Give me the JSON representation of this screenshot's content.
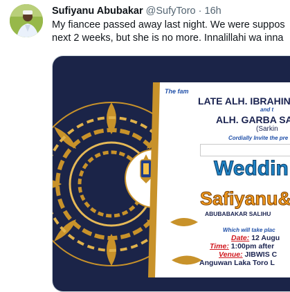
{
  "tweet": {
    "author_name": "Sufiyanu Abubakar",
    "handle": "@SufyToro",
    "separator": "·",
    "time": "16h",
    "text_line1": "My fiancee passed away last night. We were suppos",
    "text_line2": "next 2 weeks, but she is no more. Innalillahi wa inna"
  },
  "invitation": {
    "family_line": "The fam",
    "late_line": "LATE ALH. IBRAHIN",
    "and_the": "and t",
    "garba_line": "ALH. GARBA SA",
    "sarki_line": "(Sarkin",
    "cordially": "Cordially Invite the pre",
    "wedding": "Weddin",
    "groom": "Safiyanu",
    "amp": "&",
    "groom_full": "ABUBABAKAR SALIHU",
    "which_line": "Which will take plac",
    "date_label": "Date:",
    "date_value": "12 Augu",
    "time_label": "Time:",
    "time_value": "1:00pm after",
    "venue_label": "Venue:",
    "venue_value": "JIBWIS C",
    "location": "Anguwan Laka Toro L"
  },
  "colors": {
    "navy": "#1b2448",
    "gold": "#c8922a",
    "wedding_blue": "#1e82c4",
    "groom_orange": "#f29a1e",
    "label_red": "#d0181e"
  }
}
